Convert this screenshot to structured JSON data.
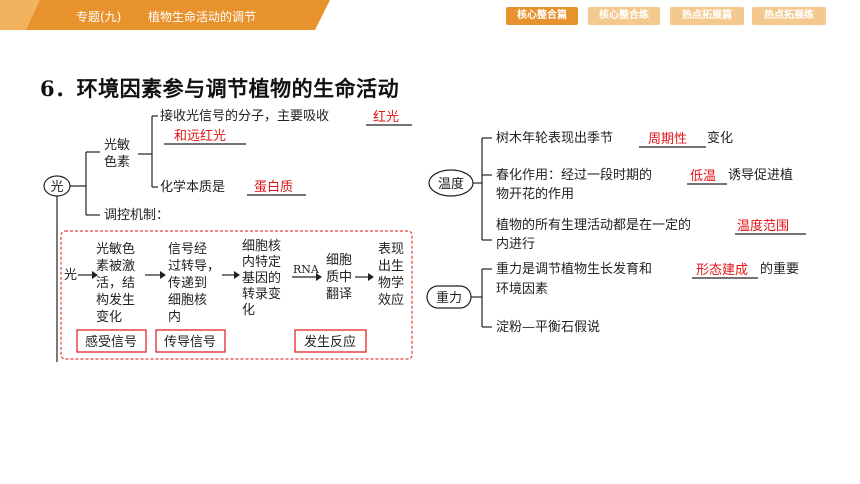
{
  "header": {
    "topic": "专题(九)",
    "title": "植物生命活动的调节",
    "tabs": [
      {
        "label": "核心整合篇",
        "active": true
      },
      {
        "label": "核心整合练",
        "active": false
      },
      {
        "label": "热点拓展篇",
        "active": false
      },
      {
        "label": "热点拓展练",
        "active": false
      }
    ]
  },
  "heading": "6．环境因素参与调节植物的生命活动",
  "light": {
    "root": "光",
    "pigment": [
      "光敏",
      "色素"
    ],
    "absorb_prefix": "接收光信号的分子，主要吸收",
    "absorb_ans1": "红光",
    "absorb_ans2": "和远红光",
    "nature_prefix": "化学本质是",
    "nature_ans": "蛋白质",
    "mechanism": "调控机制：",
    "flow_start": "光",
    "step1": [
      "光敏色",
      "素被激",
      "活，结",
      "构发生",
      "变化"
    ],
    "step2": [
      "信号经",
      "过转导，",
      "传递到",
      "细胞核",
      "内"
    ],
    "step3": [
      "细胞核",
      "内特定",
      "基因的",
      "转录变",
      "化"
    ],
    "rna": "RNA",
    "step4": [
      "细胞",
      "质中",
      "翻译"
    ],
    "step5": [
      "表现",
      "出生",
      "物学",
      "效应"
    ],
    "label1": "感受信号",
    "label2": "传导信号",
    "label3": "发生反应"
  },
  "temperature": {
    "root": "温度",
    "item1_prefix": "树木年轮表现出季节",
    "item1_ans": "周期性",
    "item1_suffix": "变化",
    "item2_prefix": "春化作用：经过一段时期的",
    "item2_ans": "低温",
    "item2_suffix": "诱导促进植",
    "item2_line2": "物开花的作用",
    "item3_prefix": "植物的所有生理活动都是在一定的",
    "item3_ans": "温度范围",
    "item3_line2": "内进行"
  },
  "gravity": {
    "root": "重力",
    "item1_prefix": "重力是调节植物生长发育和",
    "item1_ans": "形态建成",
    "item1_suffix": "的重要",
    "item1_line2": "环境因素",
    "item2": "淀粉—平衡石假说"
  },
  "colors": {
    "accent": "#e8922e",
    "accent_light": "#f4c98e",
    "answer": "#e01515"
  }
}
